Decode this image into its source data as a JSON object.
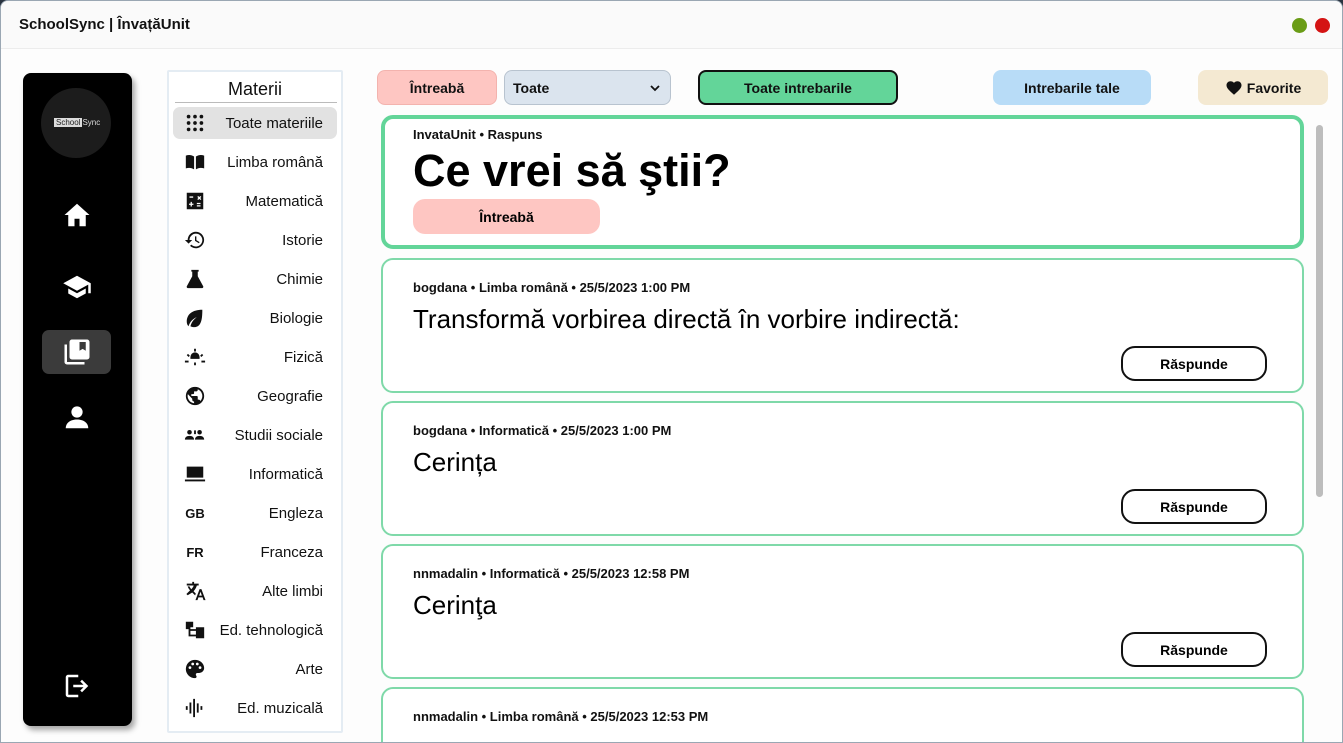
{
  "window": {
    "title": "SchoolSync | ÎnvațăUnit"
  },
  "logo": {
    "text_box": "School",
    "text_rest": "Sync"
  },
  "nav": {
    "items": [
      {
        "icon": "home-icon"
      },
      {
        "icon": "graduation-cap-icon"
      },
      {
        "icon": "library-books-icon",
        "active": true
      },
      {
        "icon": "person-icon"
      },
      {
        "icon": "logout-icon"
      }
    ]
  },
  "subjects": {
    "title": "Materii",
    "items": [
      {
        "label": "Toate materiile",
        "icon": "grid-dots-icon",
        "active": true
      },
      {
        "label": "Limba română",
        "icon": "open-book-icon"
      },
      {
        "label": "Matematică",
        "icon": "calculator-icon"
      },
      {
        "label": "Istorie",
        "icon": "history-icon"
      },
      {
        "label": "Chimie",
        "icon": "flask-icon"
      },
      {
        "label": "Biologie",
        "icon": "leaf-icon"
      },
      {
        "label": "Fizică",
        "icon": "light-icon"
      },
      {
        "label": "Geografie",
        "icon": "globe-icon"
      },
      {
        "label": "Studii sociale",
        "icon": "people-icon"
      },
      {
        "label": "Informatică",
        "icon": "laptop-icon"
      },
      {
        "label": "Engleza",
        "icon": "gb-text-icon",
        "icon_text": "GB"
      },
      {
        "label": "Franceza",
        "icon": "fr-text-icon",
        "icon_text": "FR"
      },
      {
        "label": "Alte limbi",
        "icon": "translate-icon"
      },
      {
        "label": "Ed. tehnologică",
        "icon": "schema-icon"
      },
      {
        "label": "Arte",
        "icon": "palette-icon"
      },
      {
        "label": "Ed. muzicală",
        "icon": "audio-wave-icon"
      }
    ]
  },
  "toolbar": {
    "ask_label": "Întreabă",
    "filter_value": "Toate",
    "all_questions_label": "Toate intrebarile",
    "your_questions_label": "Intrebarile tale",
    "favorites_label": "Favorite"
  },
  "hero": {
    "meta": "InvataUnit • Raspuns",
    "title": "Ce vrei să ştii?",
    "ask_label": "Întreabă"
  },
  "questions": [
    {
      "meta": "bogdana • Limba română • 25/5/2023 1:00 PM",
      "text": "Transformă vorbirea directă în vorbire indirectă:",
      "reply_label": "Răspunde"
    },
    {
      "meta": "bogdana • Informatică • 25/5/2023 1:00 PM",
      "text": "Cerința",
      "reply_label": "Răspunde"
    },
    {
      "meta": "nnmadalin • Informatică • 25/5/2023 12:58 PM",
      "text": "Cerinţa",
      "reply_label": "Răspunde"
    },
    {
      "meta": "nnmadalin • Limba română • 25/5/2023 12:53 PM",
      "text": "",
      "reply_label": ""
    }
  ],
  "colors": {
    "accent_green": "#63d599",
    "ask_pink": "#fec6c2",
    "yours_blue": "#b8dcf7",
    "fav_beige": "#f4e9d2",
    "close_red": "#d41414",
    "min_green": "#6a9c16"
  }
}
